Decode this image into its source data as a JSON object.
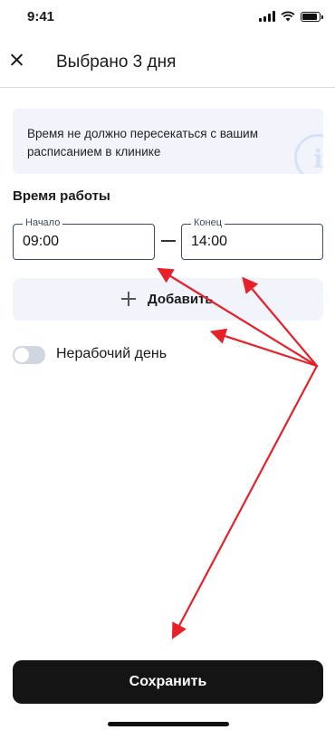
{
  "status_bar": {
    "time": "9:41"
  },
  "header": {
    "title": "Выбрано 3 дня"
  },
  "info_banner": {
    "text": "Время не должно пересекаться с вашим расписанием в клинике"
  },
  "section": {
    "title": "Время работы"
  },
  "start_field": {
    "label": "Начало",
    "value": "09:00"
  },
  "end_field": {
    "label": "Конец",
    "value": "14:00"
  },
  "add_button": {
    "label": "Добавить"
  },
  "day_off": {
    "label": "Нерабочий день",
    "enabled": false
  },
  "save_button": {
    "label": "Сохранить"
  },
  "annotation_color": "#e8202a"
}
